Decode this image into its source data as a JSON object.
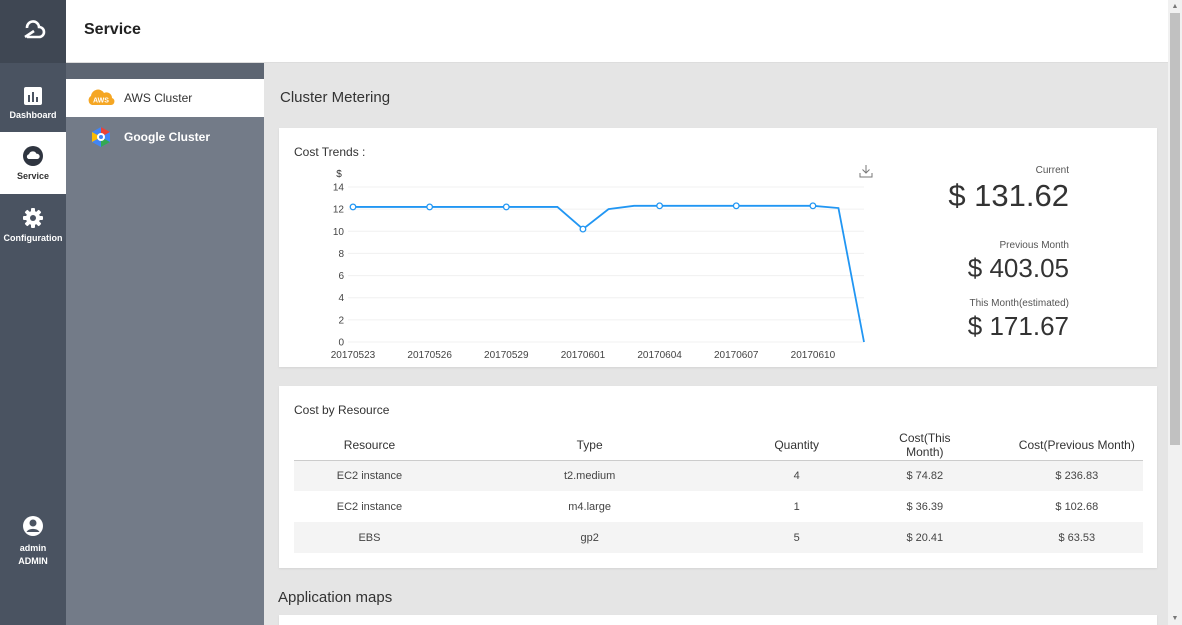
{
  "header": {
    "title": "Service"
  },
  "rail": {
    "items": [
      {
        "label": "Dashboard",
        "icon": "bar-chart-icon"
      },
      {
        "label": "Service",
        "icon": "cloud-icon"
      },
      {
        "label": "Configuration",
        "icon": "gear-icon"
      }
    ],
    "user": {
      "name": "admin",
      "role": "ADMIN"
    }
  },
  "subnav": {
    "items": [
      {
        "label": "AWS Cluster",
        "icon": "aws-icon",
        "icon_text": "AWS"
      },
      {
        "label": "Google Cluster",
        "icon": "google-cloud-icon"
      }
    ]
  },
  "main": {
    "section_title": "Cluster Metering",
    "trend": {
      "label": "Cost Trends :",
      "metrics": [
        {
          "label": "Current",
          "value": "$ 131.62"
        },
        {
          "label": "Previous Month",
          "value": "$ 403.05"
        },
        {
          "label": "This Month(estimated)",
          "value": "$ 171.67"
        }
      ]
    },
    "resource": {
      "label": "Cost by Resource",
      "columns": [
        "Resource",
        "Type",
        "Quantity",
        "Cost(This Month)",
        "Cost(Previous Month)"
      ],
      "rows": [
        [
          "EC2 instance",
          "t2.medium",
          "4",
          "$ 74.82",
          "$ 236.83"
        ],
        [
          "EC2 instance",
          "m4.large",
          "1",
          "$ 36.39",
          "$ 102.68"
        ],
        [
          "EBS",
          "gp2",
          "5",
          "$ 20.41",
          "$ 63.53"
        ]
      ]
    },
    "app_maps_title": "Application maps"
  },
  "chart_data": {
    "type": "line",
    "title": "Cost Trends :",
    "ylabel": "$",
    "ylim": [
      0,
      14
    ],
    "yticks": [
      0,
      2,
      4,
      6,
      8,
      10,
      12,
      14
    ],
    "xticks": [
      "20170523",
      "20170526",
      "20170529",
      "20170601",
      "20170604",
      "20170607",
      "20170610"
    ],
    "x": [
      "20170523",
      "20170524",
      "20170525",
      "20170526",
      "20170527",
      "20170528",
      "20170529",
      "20170530",
      "20170531",
      "20170601",
      "20170602",
      "20170603",
      "20170604",
      "20170605",
      "20170606",
      "20170607",
      "20170608",
      "20170609",
      "20170610",
      "20170611",
      "20170612"
    ],
    "series": [
      {
        "values": [
          12.2,
          12.2,
          12.2,
          12.2,
          12.2,
          12.2,
          12.2,
          12.2,
          12.2,
          10.2,
          12.0,
          12.3,
          12.3,
          12.3,
          12.3,
          12.3,
          12.3,
          12.3,
          12.3,
          12.1,
          0
        ]
      }
    ],
    "marked_points": [
      0,
      3,
      6,
      9,
      12,
      15,
      18
    ],
    "color": "#2196f3"
  }
}
